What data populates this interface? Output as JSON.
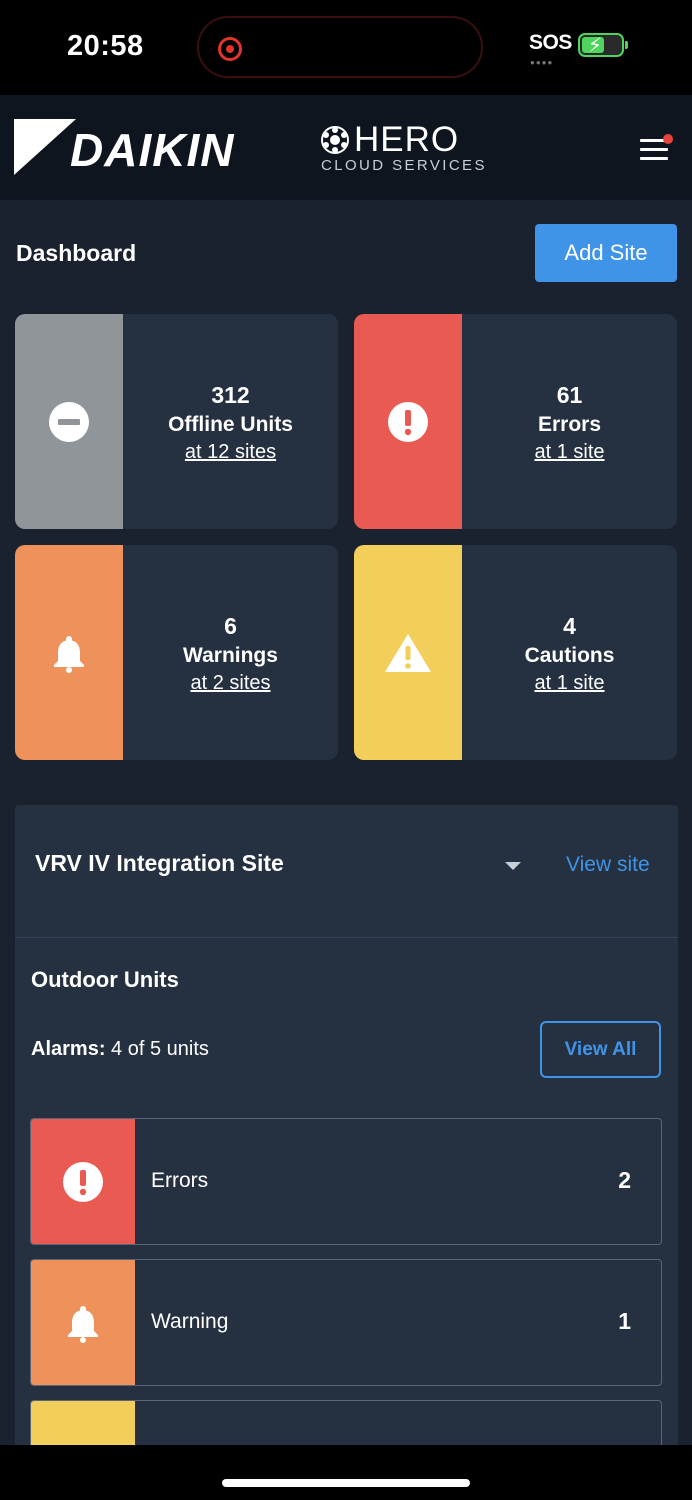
{
  "status_bar": {
    "time": "20:58",
    "carrier": "SOS"
  },
  "header": {
    "brand": "DAIKIN",
    "product": "HERO",
    "product_sub": "CLOUD SERVICES",
    "menu_icon": "hamburger-menu-icon",
    "notification_color": "#e8433a"
  },
  "dashboard": {
    "title": "Dashboard",
    "add_site_label": "Add Site",
    "cards": [
      {
        "count": "312",
        "label": "Offline Units",
        "link": "at 12 sites",
        "color": "#8f9599",
        "icon": "minus-circle-icon"
      },
      {
        "count": "61",
        "label": "Errors",
        "link": "at 1 site",
        "color": "#e95a52",
        "icon": "exclamation-circle-icon"
      },
      {
        "count": "6",
        "label": "Warnings",
        "link": "at 2 sites",
        "color": "#ef915a",
        "icon": "bell-icon"
      },
      {
        "count": "4",
        "label": "Cautions",
        "link": "at 1 site",
        "color": "#f2ce5a",
        "icon": "warning-triangle-icon"
      }
    ]
  },
  "site": {
    "name": "VRV IV Integration Site",
    "view_site_label": "View site",
    "section_title": "Outdoor Units",
    "alarms_label": "Alarms:",
    "alarms_value": "4 of 5 units",
    "view_all_label": "View All",
    "rows": [
      {
        "label": "Errors",
        "count": "2",
        "color": "#e95a52",
        "icon": "exclamation-circle-icon"
      },
      {
        "label": "Warning",
        "count": "1",
        "color": "#ef915a",
        "icon": "bell-icon"
      },
      {
        "label": "",
        "count": "",
        "color": "#f2ce5a",
        "icon": "warning-triangle-icon"
      }
    ]
  },
  "colors": {
    "accent": "#3f94e8",
    "background": "#1a2230",
    "card": "#253041",
    "header": "#0f151e"
  }
}
